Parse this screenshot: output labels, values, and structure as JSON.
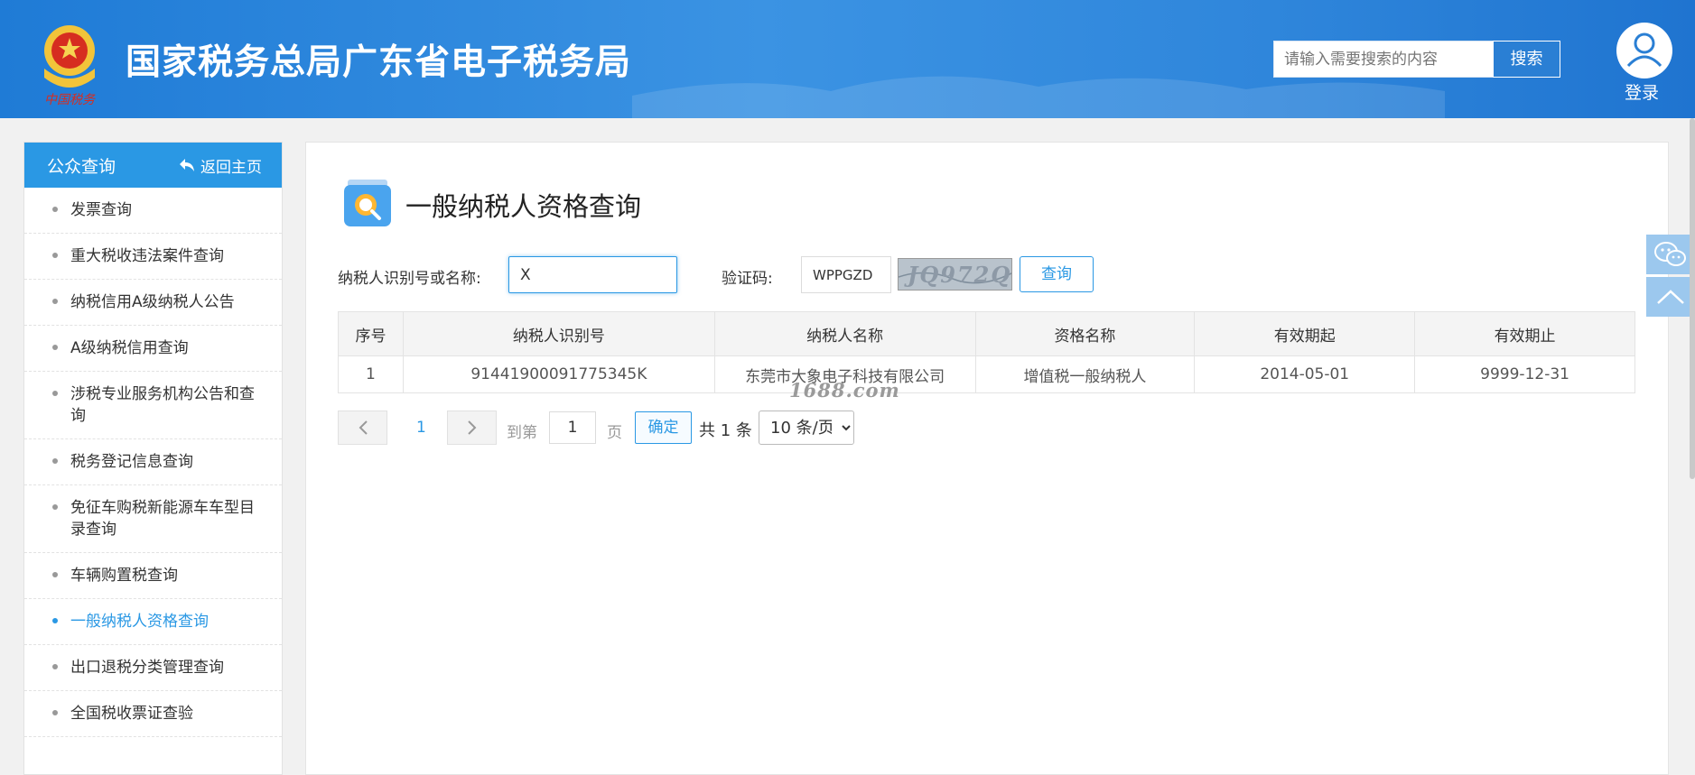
{
  "header": {
    "logo_text": "中国税务",
    "site_title": "国家税务总局广东省电子税务局",
    "search_placeholder": "请输入需要搜索的内容",
    "search_button": "搜索",
    "login_label": "登录"
  },
  "sidebar": {
    "title": "公众查询",
    "back_label": "返回主页",
    "items": [
      {
        "label": "发票查询"
      },
      {
        "label": "重大税收违法案件查询"
      },
      {
        "label": "纳税信用A级纳税人公告"
      },
      {
        "label": "A级纳税信用查询"
      },
      {
        "label": "涉税专业服务机构公告和查询"
      },
      {
        "label": "税务登记信息查询"
      },
      {
        "label": "免征车购税新能源车车型目录查询"
      },
      {
        "label": "车辆购置税查询"
      },
      {
        "label": "一般纳税人资格查询"
      },
      {
        "label": "出口退税分类管理查询"
      },
      {
        "label": "全国税收票证查验"
      }
    ],
    "active_index": 8
  },
  "main": {
    "page_title": "一般纳税人资格查询",
    "taxid_label": "纳税人识别号或名称:",
    "taxid_value": "X",
    "captcha_label": "验证码:",
    "captcha_value": "WPPGZD",
    "captcha_image_text": "JQ972Q",
    "query_button": "查询",
    "table": {
      "headers": [
        "序号",
        "纳税人识别号",
        "纳税人名称",
        "资格名称",
        "有效期起",
        "有效期止"
      ],
      "rows": [
        [
          "1",
          "91441900091775345K",
          "东莞市大象电子科技有限公司",
          "增值税一般纳税人",
          "2014-05-01",
          "9999-12-31"
        ]
      ]
    },
    "watermark": "1688.com",
    "pagination": {
      "current_page": "1",
      "goto_label": "到第",
      "goto_value": "1",
      "page_unit": "页",
      "confirm": "确定",
      "total": "共 1 条",
      "page_size": "10 条/页"
    }
  },
  "colors": {
    "header_blue": "#2f86db",
    "accent": "#2a98e4"
  },
  "icons": {
    "logo": "tax-emblem-icon",
    "avatar": "user-icon",
    "back": "back-arrow-icon",
    "title": "search-document-icon",
    "prev": "chevron-left-icon",
    "next": "chevron-right-icon",
    "float_1": "wechat-icon",
    "float_2": "back-to-top-icon"
  }
}
